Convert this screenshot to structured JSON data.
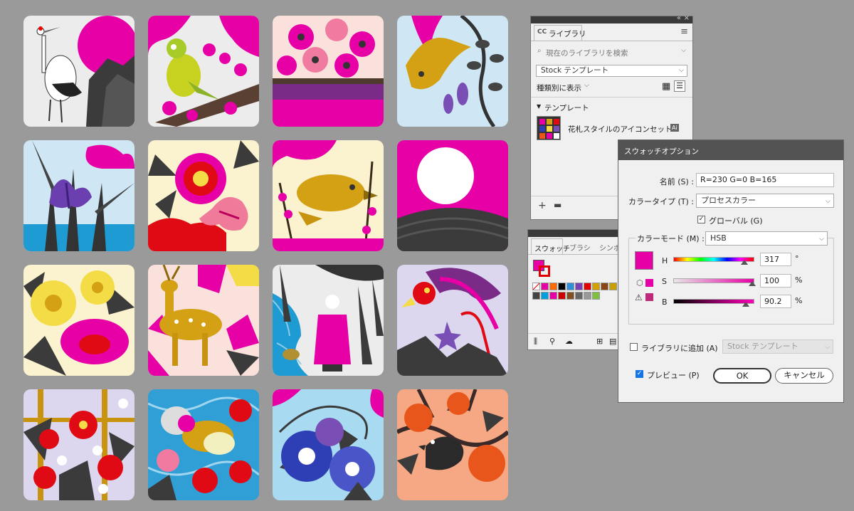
{
  "library_panel": {
    "brand": "CC",
    "title": "ライブラリ",
    "collapse": "«",
    "close": "×",
    "menu": "≡",
    "search_placeholder": "現在のライブラリを検索",
    "library_select": "Stock テンプレート",
    "view_by": "種類別に表示",
    "section_title": "テンプレート",
    "item_name": "花札スタイルのアイコンセット",
    "item_badge": "Ai",
    "add": "+"
  },
  "swatches_panel": {
    "tabs": [
      "スウォッチ",
      "ブラシ",
      "シンボ"
    ],
    "colors": [
      "#e600a5",
      "#ff6b00",
      "#000000",
      "#2f8fd8",
      "#7d3fb5",
      "#e00000",
      "#d4a000",
      "#8b4513",
      "#c8a000",
      "#444444",
      "#00a0e0",
      "#e600a5",
      "#cc0000",
      "#805020",
      "#666666",
      "#999999",
      "#7fbf3f"
    ]
  },
  "swatch_options": {
    "title": "スウォッチオプション",
    "name_label": "名前 (S) :",
    "name_value": "R=230 G=0 B=165",
    "color_type_label": "カラータイプ (T) :",
    "color_type_value": "プロセスカラー",
    "global_label": "グローバル (G)",
    "color_mode_label": "カラーモード (M) :",
    "color_mode_value": "HSB",
    "swatch_color": "#e600a5",
    "h_label": "H",
    "h_value": "317",
    "h_unit": "°",
    "s_label": "S",
    "s_value": "100",
    "s_unit": "%",
    "b_label": "B",
    "b_value": "90.2",
    "b_unit": "%",
    "add_to_library_label": "ライブラリに追加 (A)",
    "add_to_library_select": "Stock テンプレート",
    "preview_label": "プレビュー (P)",
    "ok": "OK",
    "cancel": "キャンセル"
  }
}
